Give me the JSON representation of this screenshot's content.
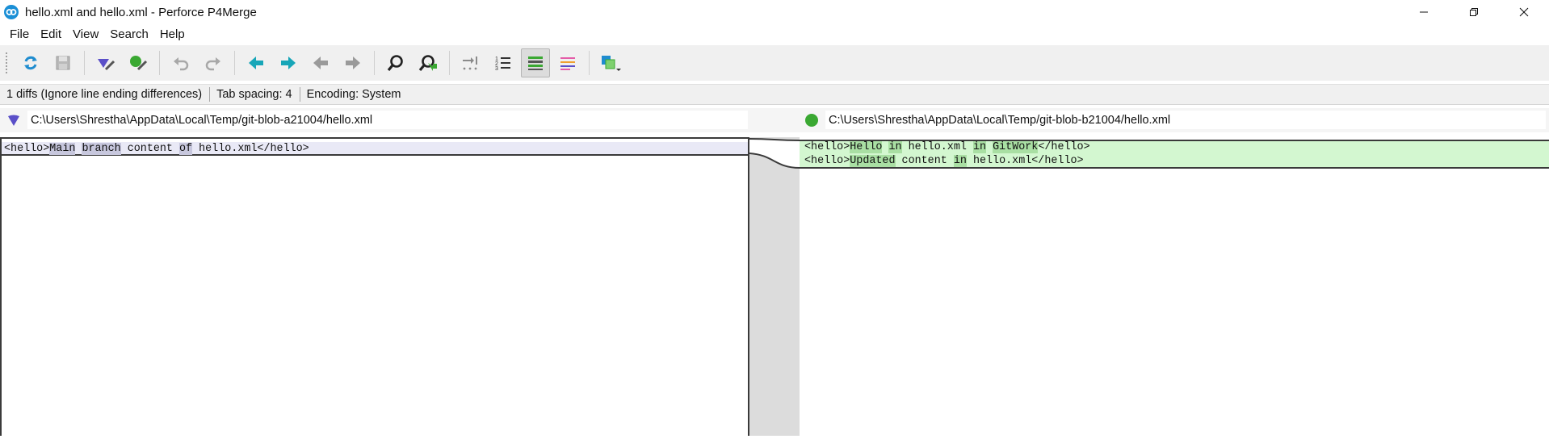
{
  "window": {
    "title": "hello.xml and hello.xml - Perforce P4Merge"
  },
  "menu": {
    "items": [
      {
        "label": "File"
      },
      {
        "label": "Edit"
      },
      {
        "label": "View"
      },
      {
        "label": "Search"
      },
      {
        "label": "Help"
      }
    ]
  },
  "toolbar": {
    "buttons": [
      {
        "name": "refresh-icon"
      },
      {
        "name": "save-icon"
      },
      {
        "name": "edit-left-icon"
      },
      {
        "name": "edit-right-icon"
      },
      {
        "name": "undo-icon"
      },
      {
        "name": "redo-icon"
      },
      {
        "name": "previous-diff-icon"
      },
      {
        "name": "next-diff-icon"
      },
      {
        "name": "previous-change-icon"
      },
      {
        "name": "next-change-icon"
      },
      {
        "name": "find-icon"
      },
      {
        "name": "go-to-icon"
      },
      {
        "name": "show-whitespace-icon"
      },
      {
        "name": "line-numbers-icon"
      },
      {
        "name": "diff-view-icon"
      },
      {
        "name": "inline-view-icon"
      },
      {
        "name": "layout-icon"
      }
    ]
  },
  "status": {
    "diffs": "1 diffs (Ignore line ending differences)",
    "tab_spacing": "Tab spacing: 4",
    "encoding": "Encoding: System"
  },
  "files": {
    "left_path": "C:\\Users\\Shrestha\\AppData\\Local\\Temp/git-blob-a21004/hello.xml",
    "right_path": "C:\\Users\\Shrestha\\AppData\\Local\\Temp/git-blob-b21004/hello.xml"
  },
  "diff": {
    "left_lines": [
      {
        "segments": [
          {
            "text": "<hello>",
            "hl": false
          },
          {
            "text": "Main",
            "hl": true
          },
          {
            "text": " ",
            "hl": false
          },
          {
            "text": "branch",
            "hl": true
          },
          {
            "text": " content ",
            "hl": false
          },
          {
            "text": "of",
            "hl": true
          },
          {
            "text": " hello.xml</hello>",
            "hl": false
          }
        ]
      }
    ],
    "right_lines": [
      {
        "segments": [
          {
            "text": "<hello>",
            "hl": false
          },
          {
            "text": "Hello",
            "hl": true
          },
          {
            "text": " ",
            "hl": false
          },
          {
            "text": "in",
            "hl": true
          },
          {
            "text": " hello.xml ",
            "hl": false
          },
          {
            "text": "in",
            "hl": true
          },
          {
            "text": " ",
            "hl": false
          },
          {
            "text": "GitWork",
            "hl": true
          },
          {
            "text": "</hello>",
            "hl": false
          }
        ]
      },
      {
        "segments": [
          {
            "text": "<hello>",
            "hl": false
          },
          {
            "text": "Updated",
            "hl": true
          },
          {
            "text": " content ",
            "hl": false
          },
          {
            "text": "in",
            "hl": true
          },
          {
            "text": " hello.xml</hello>",
            "hl": false
          }
        ]
      }
    ]
  },
  "colors": {
    "left_marker": "#5a4fc8",
    "right_marker": "#3aa832",
    "added_background": "#d3f7d0",
    "changed_background": "#e9e9f6",
    "toolbar_accent": "#17a6b8"
  }
}
